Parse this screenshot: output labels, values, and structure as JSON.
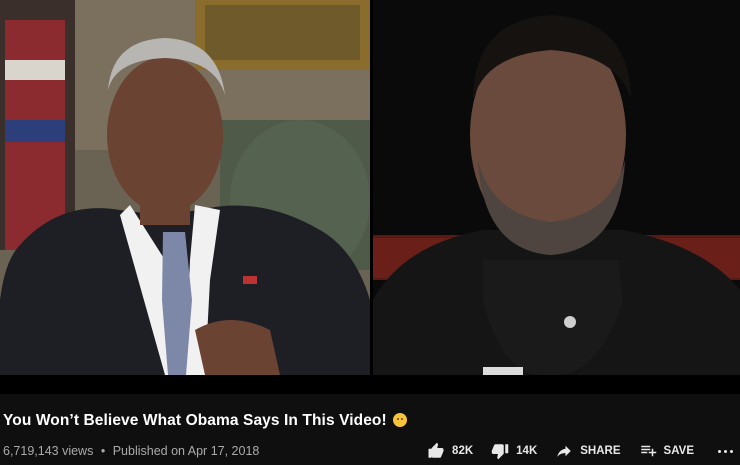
{
  "video": {
    "title": "You Won’t Believe What Obama Says In This Video!",
    "title_emoji": "worried-face-emoji",
    "views": "6,719,143 views",
    "separator": "•",
    "published": "Published on Apr 17, 2018"
  },
  "actions": {
    "like_count": "82K",
    "dislike_count": "14K",
    "share_label": "SHARE",
    "save_label": "SAVE",
    "more_icon": "more-horizontal-icon"
  },
  "colors": {
    "page_bg": "#0f0f0f",
    "secondary_text": "#aaaaaa",
    "action_text": "#e8e8e8"
  }
}
